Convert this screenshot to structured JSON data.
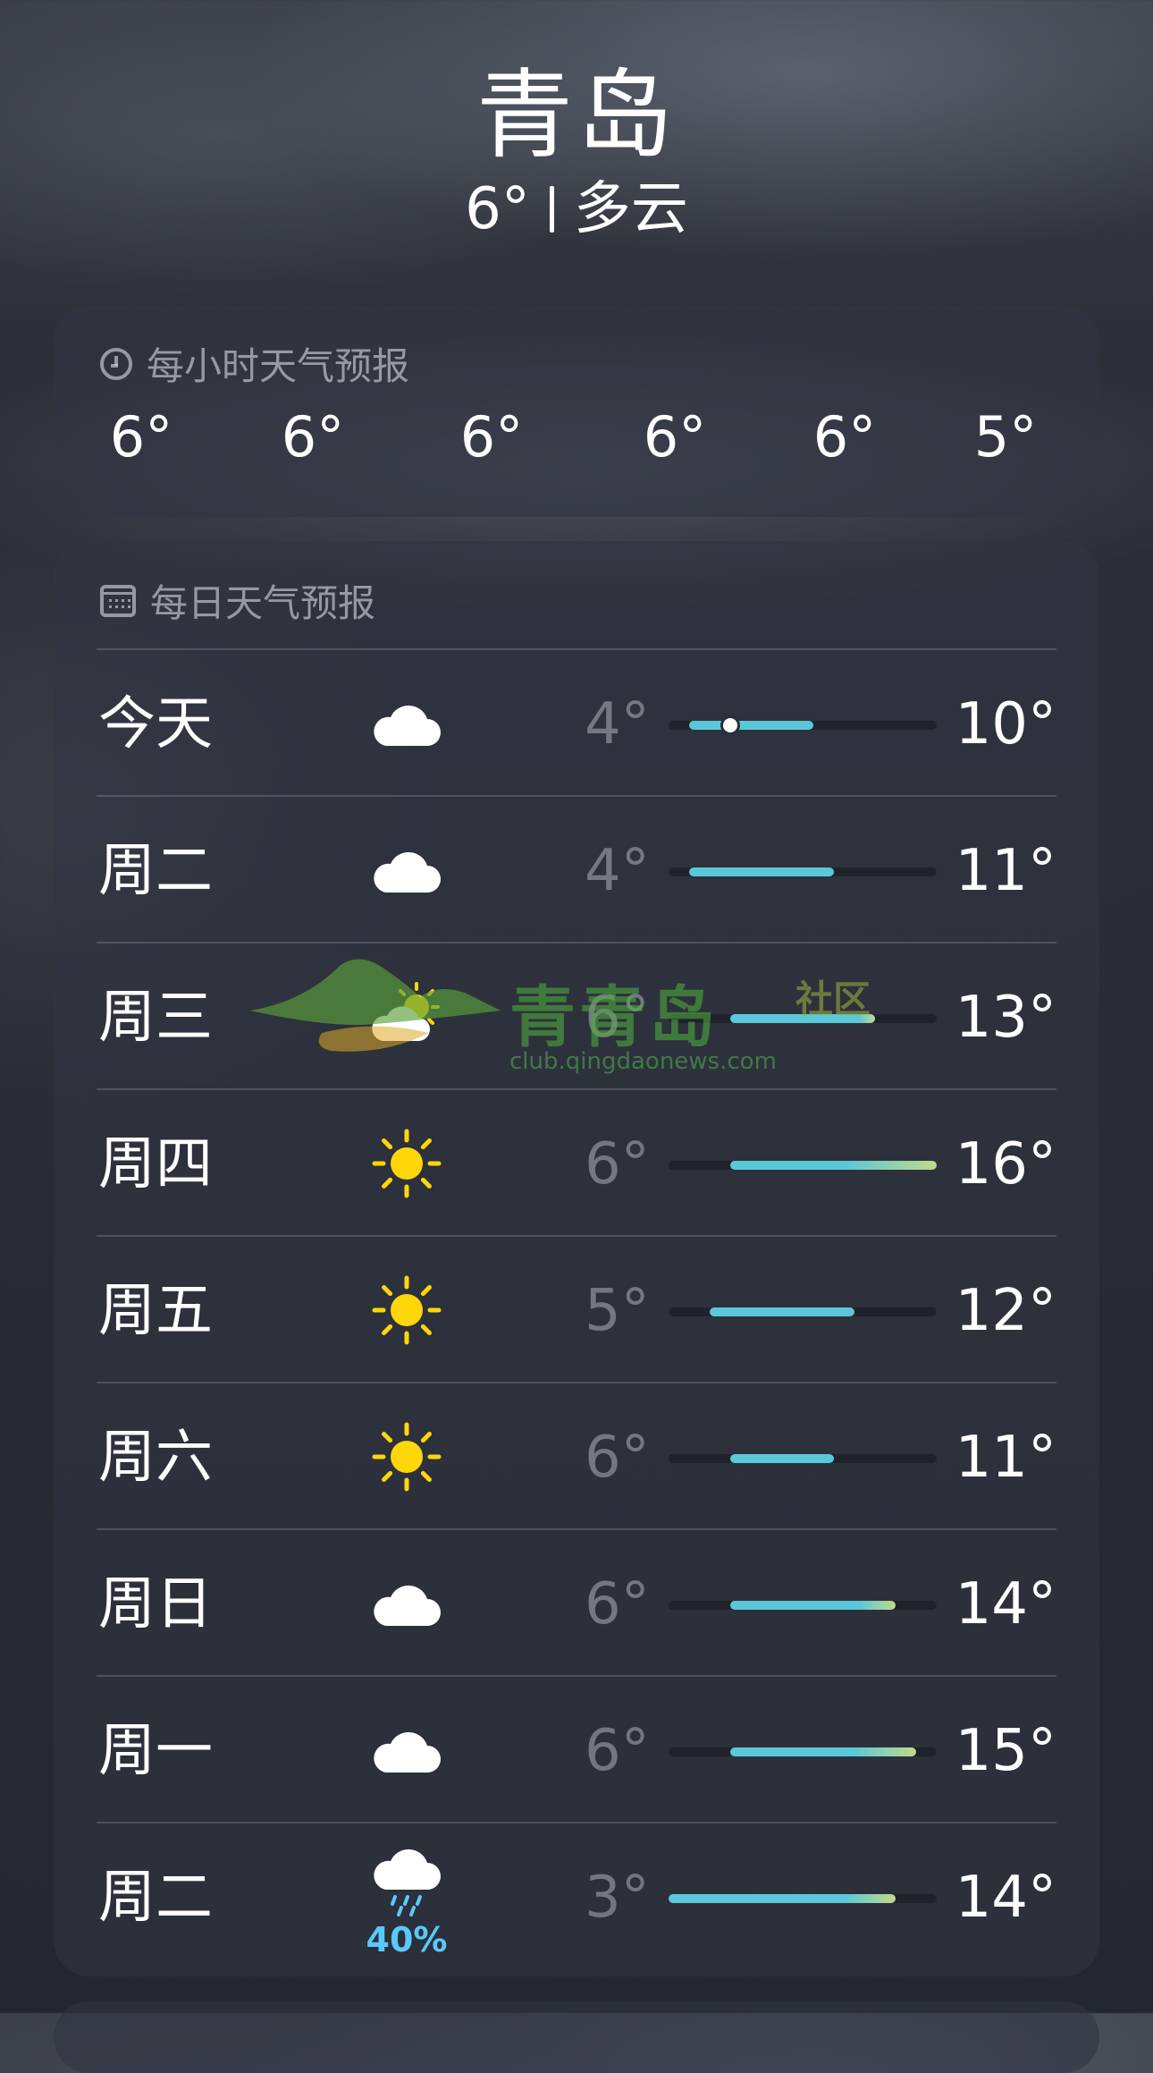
{
  "location": {
    "city": "青岛",
    "temperature": "6°",
    "condition": "多云"
  },
  "hourly": {
    "title": "每小时天气预报",
    "icon": "clock-icon",
    "temps": [
      "6°",
      "6°",
      "6°",
      "6°",
      "6°",
      "5°"
    ]
  },
  "daily": {
    "title": "每日天气预报",
    "icon": "calendar-icon",
    "scale": {
      "min": 3,
      "max": 16
    },
    "current_temp": 6,
    "days": [
      {
        "label": "今天",
        "icon": "cloud-icon",
        "low": "4°",
        "high": "10°",
        "low_value": 4,
        "high_value": 10,
        "current": true
      },
      {
        "label": "周二",
        "icon": "cloud-icon",
        "low": "4°",
        "high": "11°",
        "low_value": 4,
        "high_value": 11
      },
      {
        "label": "周三",
        "icon": "partly-sunny-icon",
        "low": "6°",
        "high": "13°",
        "low_value": 6,
        "high_value": 13
      },
      {
        "label": "周四",
        "icon": "sun-icon",
        "low": "6°",
        "high": "16°",
        "low_value": 6,
        "high_value": 16
      },
      {
        "label": "周五",
        "icon": "sun-icon",
        "low": "5°",
        "high": "12°",
        "low_value": 5,
        "high_value": 12
      },
      {
        "label": "周六",
        "icon": "sun-icon",
        "low": "6°",
        "high": "11°",
        "low_value": 6,
        "high_value": 11
      },
      {
        "label": "周日",
        "icon": "cloud-icon",
        "low": "6°",
        "high": "14°",
        "low_value": 6,
        "high_value": 14
      },
      {
        "label": "周一",
        "icon": "cloud-icon",
        "low": "6°",
        "high": "15°",
        "low_value": 6,
        "high_value": 15
      },
      {
        "label": "周二",
        "icon": "cloud-rain-icon",
        "low": "3°",
        "high": "14°",
        "low_value": 3,
        "high_value": 14,
        "precipitation": "40%"
      }
    ]
  },
  "watermark": {
    "brand": "青青岛",
    "suffix": "社区",
    "url": "club.qingdaonews.com"
  },
  "colors": {
    "bar_cool": "#5ac8d8",
    "bar_warm": "#c2d98a",
    "precipitation": "#5ac8fa"
  }
}
